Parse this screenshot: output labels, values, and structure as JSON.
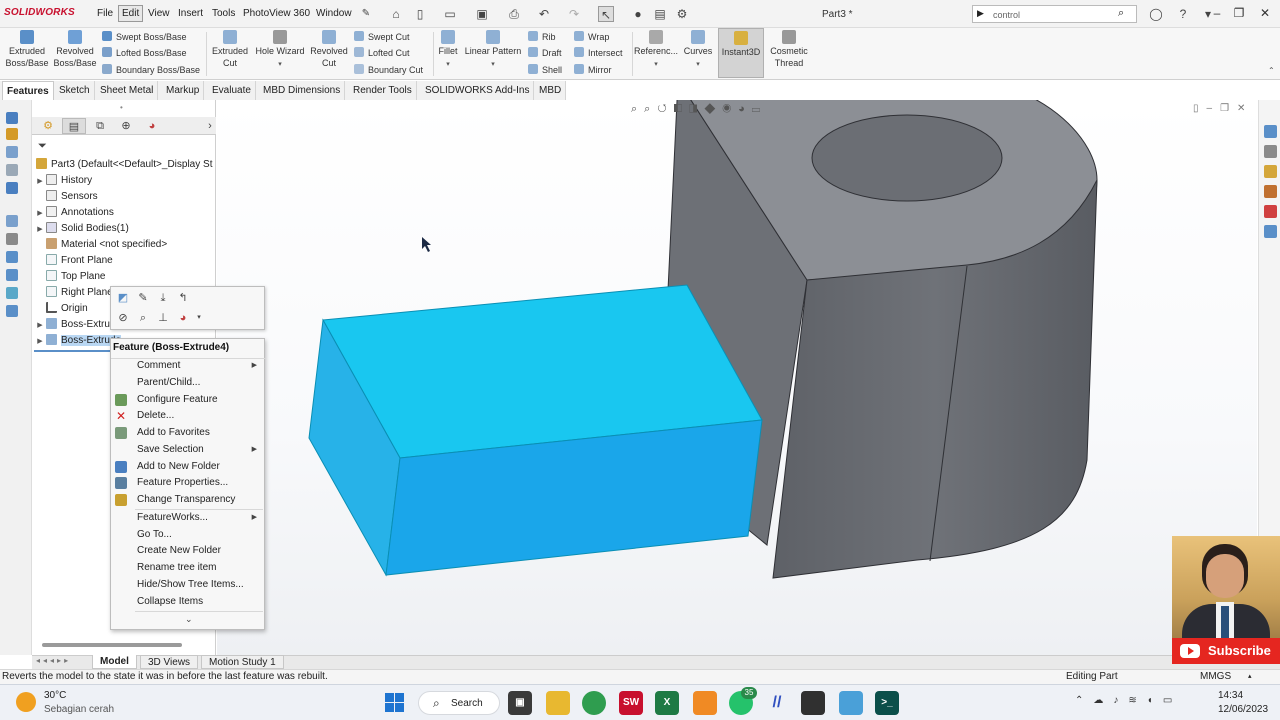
{
  "app": {
    "brand": "SOLIDWORKS",
    "doc_title": "Part3 *"
  },
  "menu": [
    "File",
    "Edit",
    "View",
    "Insert",
    "Tools",
    "PhotoView 360",
    "Window"
  ],
  "search": {
    "value": "control"
  },
  "ribbon": {
    "extruded_boss": "Extruded Boss/Base",
    "revolved_boss": "Revolved Boss/Base",
    "swept_boss": "Swept Boss/Base",
    "lofted_boss": "Lofted Boss/Base",
    "boundary_boss": "Boundary Boss/Base",
    "extruded_cut": "Extruded Cut",
    "hole_wizard": "Hole Wizard",
    "revolved_cut": "Revolved Cut",
    "swept_cut": "Swept Cut",
    "lofted_cut": "Lofted Cut",
    "boundary_cut": "Boundary Cut",
    "fillet": "Fillet",
    "linear_pattern": "Linear Pattern",
    "rib": "Rib",
    "draft": "Draft",
    "shell": "Shell",
    "wrap": "Wrap",
    "intersect": "Intersect",
    "mirror": "Mirror",
    "reference": "Referenc...",
    "curves": "Curves",
    "instant3d": "Instant3D",
    "cosmetic_thread": "Cosmetic Thread"
  },
  "cm_tabs": [
    "Features",
    "Sketch",
    "Sheet Metal",
    "Markup",
    "Evaluate",
    "MBD Dimensions",
    "Render Tools",
    "SOLIDWORKS Add-Ins",
    "MBD"
  ],
  "tree": {
    "root": "Part3  (Default<<Default>_Display St",
    "items": [
      {
        "label": "History"
      },
      {
        "label": "Sensors"
      },
      {
        "label": "Annotations"
      },
      {
        "label": "Solid Bodies(1)"
      },
      {
        "label": "Material <not specified>"
      },
      {
        "label": "Front Plane"
      },
      {
        "label": "Top Plane"
      },
      {
        "label": "Right Plane"
      },
      {
        "label": "Origin"
      },
      {
        "label": "Boss-Extrude"
      },
      {
        "label": "Boss-Extrude"
      }
    ]
  },
  "context_menu": {
    "title": "Feature (Boss-Extrude4)",
    "items": [
      "Comment",
      "Parent/Child...",
      "Configure Feature",
      "Delete...",
      "Add to Favorites",
      "Save Selection",
      "Add to New Folder",
      "Feature Properties...",
      "Change Transparency",
      "FeatureWorks...",
      "Go To...",
      "Create New Folder",
      "Rename tree item",
      "Hide/Show Tree Items...",
      "Collapse Items"
    ]
  },
  "bottom_tabs": [
    "Model",
    "3D Views",
    "Motion Study 1"
  ],
  "status": {
    "message": "Reverts the model to the state it was in before the last feature was rebuilt.",
    "mode": "Editing Part",
    "units": "MMGS"
  },
  "taskbar": {
    "weather_temp": "30°C",
    "weather_desc": "Sebagian cerah",
    "search": "Search",
    "badge": "35",
    "time": "14:34",
    "date": "12/06/2023"
  },
  "overlay": {
    "subscribe": "Subscribe"
  },
  "colors": {
    "selected_body": "#15c8f2",
    "body_gray": "#6c6f75",
    "accent": "#c8102e",
    "subscribe": "#e52620"
  }
}
